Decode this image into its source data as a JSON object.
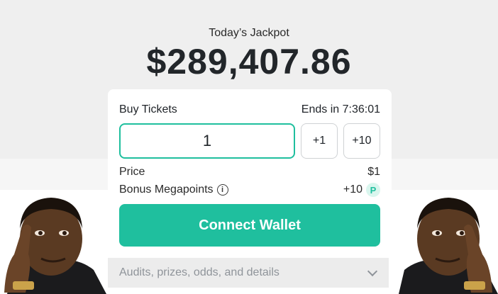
{
  "hero": {
    "label": "Today’s Jackpot",
    "amount": "$289,407.86"
  },
  "ticket_card": {
    "title": "Buy Tickets",
    "ends": "Ends in 7:36:01",
    "quantity": "1",
    "step_small": "+1",
    "step_large": "+10",
    "price_label": "Price",
    "price_value": "$1",
    "bonus_label": "Bonus Megapoints",
    "bonus_value": "+10",
    "bonus_icon_glyph": "P",
    "connect_label": "Connect Wallet"
  },
  "details": {
    "label": "Audits, prizes, odds, and details"
  },
  "colors": {
    "accent": "#1fbf9e",
    "hero_bg": "#efefef"
  },
  "icons": [
    "info-icon",
    "megapoints-icon",
    "chevron-down-icon",
    "meme-face-image"
  ]
}
